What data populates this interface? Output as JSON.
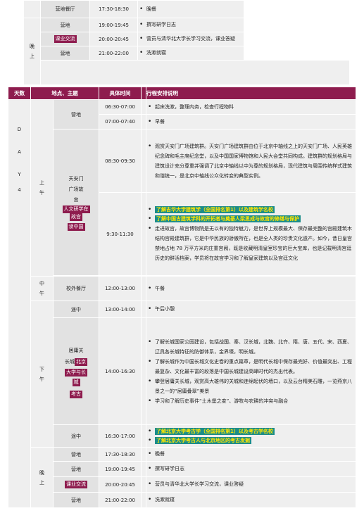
{
  "top_section": {
    "rows": [
      {
        "place": "营地餐厅",
        "time": "17:30-18:30",
        "desc": "晚餐"
      },
      {
        "place": "营地",
        "time": "19:00-19:45",
        "desc": "撰写研学日志"
      },
      {
        "place": "课业交流",
        "time": "20:00-20:45",
        "desc": "营员与清华北大学长学习交流，课业答疑"
      },
      {
        "place": "营地",
        "time": "21:00-22:00",
        "desc": "洗漱就寝"
      }
    ],
    "period_evening": "晚上"
  },
  "header": {
    "col_day": "天数",
    "col_place": "地点、主题",
    "col_time": "具体时间",
    "col_desc": "行程安排说明"
  },
  "day": {
    "label": "D A Y",
    "number": "4"
  },
  "periods": {
    "morning": "上午",
    "noon": "中午",
    "afternoon": "下午",
    "evening": "晚上"
  },
  "morning": {
    "camp_place": "营地",
    "camp_rows": [
      {
        "time": "06:30-07:00",
        "desc": "起床洗漱，整理内务，检查行程物料"
      },
      {
        "time": "07:00-07:40",
        "desc": "早餐"
      }
    ],
    "tiananmen": {
      "place_lines": [
        "天安门",
        "广场故",
        "宫"
      ],
      "tags": [
        "人文研学在",
        "故宫",
        "读中国"
      ],
      "time1": "08:30-09:30",
      "desc1": "观赏天安门广场建筑群。天安门广场建筑群由位于北京中轴线之上的天安门广场、人民英雄纪念碑和毛主席纪念堂，以及中国国家博物馆和人民大会堂共同构成。建筑群的规划格局与建筑设计充分尊重并强调了北京中轴线以中为尊的规划格局，现代建筑与周围传统样式建筑和谐统一，是北京中轴线公众化转变的典型实例。",
      "time2": "9:30-11:30",
      "hl1": "了解吉华大学建筑学（全国排名第1）以及建筑学名校",
      "hl2": "了解中国古建筑学科的开拓者与奠基人梁思成与故宫的修缮与保护",
      "desc2": "走进故宫，故宫博物院是无以有的独特魅力，是世界上规模最大、保存最完整的宫殿建筑木结构宫殿建筑群，它是中华民族的骄傲所在，也是全人类的珍贵文化遗产。如今，昔日皇宫禁地占地 78 万平方米的庄重宫阙，既是收藏明清皇室珍宝的巨大宝库，也是记载明清宫廷历史的鲜活档案，学员将在故宫学习和了解皇家建筑以及宫廷文化"
    }
  },
  "noon": {
    "place": "校外餐厅",
    "time": "12:00-13:00",
    "desc": "午餐"
  },
  "afternoon": {
    "transit1": {
      "place": "途中",
      "time": "13:00-14:00",
      "desc": "午后小憩"
    },
    "greatwall": {
      "place_lines": [
        "居庸关",
        "长城"
      ],
      "tags": [
        "北京",
        "大学与长",
        "城",
        "考古"
      ],
      "time": "14:00-16:30",
      "items": [
        "了解长城国家公园建设，包括战国、秦、汉长城，北魏、北齐、隋、唐、五代、宋、西夏、辽具各长城特征的防御体系，金界壕，明长城。",
        "了解长城作为中国长城文化史卷的重点篇章，是明代长城中保存最完好、价值最突出、工程最复杂、文化最丰富的段落是中国长城建设高峰时代的杰出代表。",
        "攀登居庸关长城，观赏高大雄伟的关城和连绵起伏的墙口，以及云台精美石雕，一览燕京八景之一的“居庸叠翠”美景",
        "学习和了解历史事件“土木堡之变”、游牧与农耕的冲突与融合"
      ]
    },
    "transit2": {
      "place": "途中",
      "time": "16:30-17:00",
      "hl1": "了解北京大学考古学（全国排名第1）以及考古学名校",
      "hl2": "了解北京大学考古人与北京地区的考古发掘"
    }
  },
  "evening": {
    "rows": [
      {
        "place": "营地",
        "time": "17:30-18:30",
        "desc": "晚餐"
      },
      {
        "place": "营地",
        "time": "19:00-19:45",
        "desc": "撰写研学日志"
      },
      {
        "place": "课业交流",
        "time": "20:00-20:45",
        "desc": "营员与清华北大学长学习交流，课业答疑"
      },
      {
        "place": "营地",
        "time": "21:00-22:00",
        "desc": "洗漱就寝"
      }
    ]
  },
  "colors": {
    "header": "#8e1c4e",
    "highlight_bg": "#1c8d8a",
    "highlight_text": "#ffe600"
  }
}
